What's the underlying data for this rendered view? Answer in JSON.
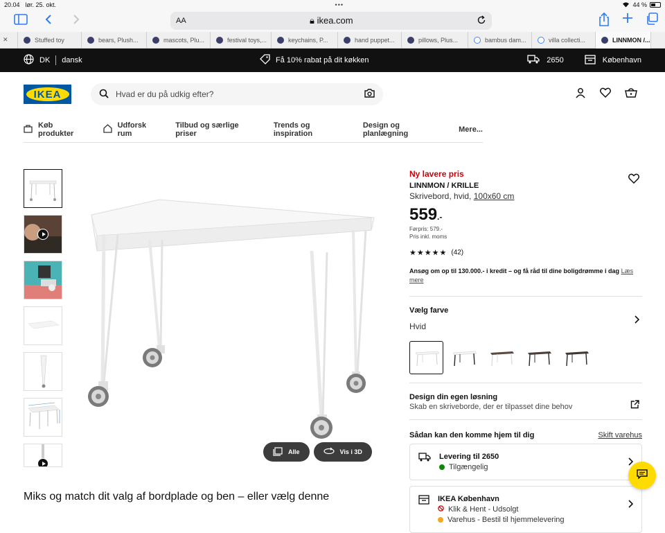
{
  "status_bar": {
    "time": "20.04",
    "date": "lør. 25. okt.",
    "dots": "•••",
    "battery": "44 %"
  },
  "browser": {
    "aa": "AA",
    "url": "ikea.com",
    "tabs": [
      {
        "label": "Stuffed toy",
        "active": false
      },
      {
        "label": "bears, Plush...",
        "active": false
      },
      {
        "label": "mascots, Plu...",
        "active": false
      },
      {
        "label": "festival toys,...",
        "active": false
      },
      {
        "label": "keychains, P...",
        "active": false
      },
      {
        "label": "hand puppet...",
        "active": false
      },
      {
        "label": "pillows, Plus...",
        "active": false
      },
      {
        "label": "bambus dam...",
        "active": false
      },
      {
        "label": "villa collecti...",
        "active": false
      },
      {
        "label": "LINNMON /...",
        "active": true
      }
    ]
  },
  "promo_bar": {
    "country": "DK",
    "language": "dansk",
    "promo": "Få 10% rabat på dit køkken",
    "postal": "2650",
    "store": "København"
  },
  "header": {
    "logo": "IKEA",
    "search_placeholder": "Hvad er du på udkig efter?"
  },
  "nav": {
    "items": [
      "Køb produkter",
      "Udforsk rum",
      "Tilbud og særlige priser",
      "Trends og inspiration",
      "Design og planlægning",
      "Mere..."
    ]
  },
  "gallery": {
    "btn_all": "Alle",
    "btn_3d": "Vis i 3D"
  },
  "mix_text": "Miks og match dit valg af bordplade og ben – eller vælg denne",
  "product": {
    "badge": "Ny lavere pris",
    "title": "LINNMON / KRILLE",
    "desc": "Skrivebord, hvid,",
    "size": "100x60 cm",
    "price": "559",
    "price_dec": ".-",
    "prev_price": "Førpris: 579.-",
    "vat": "Pris inkl. moms",
    "stars": "★★★★★",
    "reviews": "(42)",
    "credit": "Ansøg om op til 130.000.- i kredit – og få råd til dine boligdrømme i dag",
    "credit_link": "Læs mere",
    "color_label": "Vælg farve",
    "color_value": "Hvid",
    "design_title": "Design din egen løsning",
    "design_sub": "Skab en skriveborde, der er tilpasset dine behov",
    "delivery_head": "Sådan kan den komme hjem til dig",
    "change_store": "Skift varehus",
    "delivery": [
      {
        "title": "Levering til 2650",
        "status": "Tilgængelig",
        "color": "#0a8a00"
      },
      {
        "title": "IKEA København",
        "status": "Klik & Hent - Udsolgt",
        "status2": "Varehus - Bestil til hjemmelevering",
        "color": "#cc0008"
      }
    ]
  },
  "colors": {
    "brand_blue": "#0058a3",
    "brand_yellow": "#ffdb00",
    "price_red": "#cc0008"
  }
}
